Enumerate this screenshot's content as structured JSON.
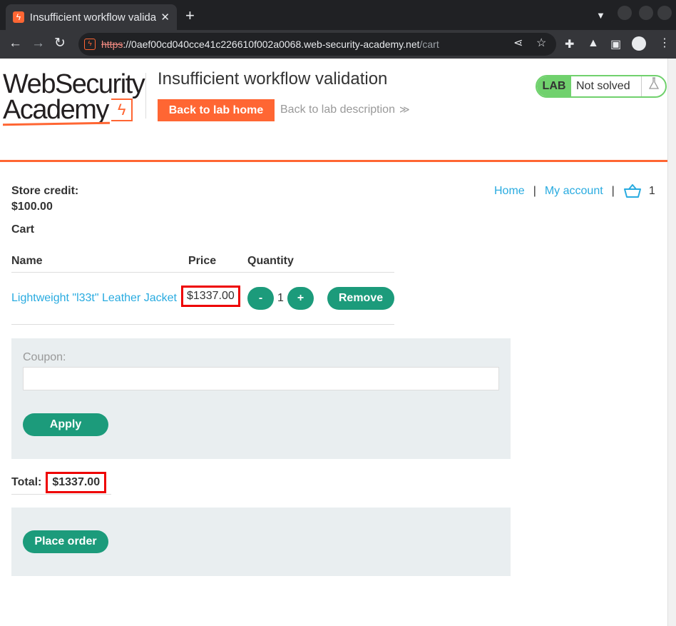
{
  "browser": {
    "tab_title": "Insufficient workflow validatio",
    "tab_close": "✕",
    "new_tab": "+",
    "url_scheme": "https",
    "url_host": "://0aef00cd040cce41c226610f002a0068.web-security-academy.net",
    "url_path": "/cart"
  },
  "header": {
    "logo_line1": "WebSecurity",
    "logo_line2": "Academy",
    "lab_title": "Insufficient workflow validation",
    "back_home": "Back to lab home",
    "back_description": "Back to lab description",
    "lab_badge": "LAB",
    "lab_status": "Not solved"
  },
  "nav": {
    "home": "Home",
    "separator": "|",
    "my_account": "My account",
    "cart_count": "1"
  },
  "account": {
    "store_credit_label": "Store credit:",
    "store_credit_value": "$100.00",
    "cart_title": "Cart"
  },
  "cart": {
    "headers": {
      "name": "Name",
      "price": "Price",
      "quantity": "Quantity"
    },
    "items": [
      {
        "name": "Lightweight \"l33t\" Leather Jacket",
        "price": "$1337.00",
        "qty": "1",
        "minus": "-",
        "plus": "+",
        "remove": "Remove"
      }
    ]
  },
  "coupon": {
    "label": "Coupon:",
    "value": "",
    "apply": "Apply"
  },
  "total": {
    "label": "Total:",
    "value": "$1337.00"
  },
  "order": {
    "place_order": "Place order"
  },
  "colors": {
    "accent": "#ff6633",
    "button": "#1c9b7b",
    "link": "#29abe0",
    "highlight": "#e00000",
    "lab_green": "#70d16d"
  }
}
